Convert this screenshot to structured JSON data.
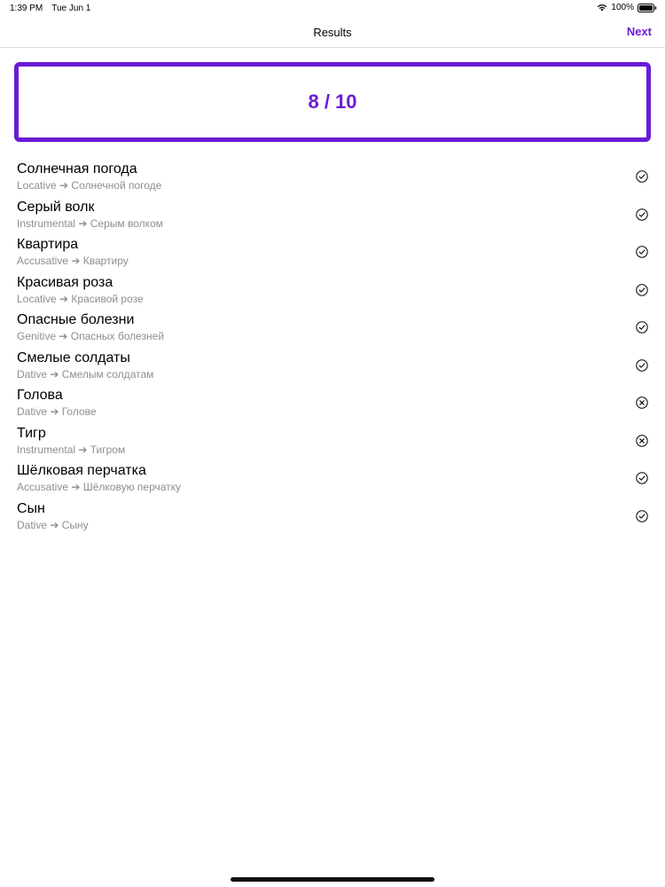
{
  "status": {
    "time": "1:39 PM",
    "date": "Tue Jun 1",
    "battery": "100%",
    "wifi_icon": "wifi-icon",
    "battery_icon": "battery-icon"
  },
  "nav": {
    "title": "Results",
    "next_label": "Next"
  },
  "score": {
    "text": "8 / 10",
    "correct": 8,
    "total": 10
  },
  "colors": {
    "accent": "#6a1bd6",
    "secondary_text": "#8e8e93"
  },
  "results": [
    {
      "word": "Солнечная погода",
      "detail": "Locative ➔ Солнечной погоде",
      "correct": true
    },
    {
      "word": "Серый волк",
      "detail": "Instrumental ➔ Серым волком",
      "correct": true
    },
    {
      "word": "Квартира",
      "detail": "Accusative ➔ Квартиру",
      "correct": true
    },
    {
      "word": "Красивая роза",
      "detail": "Locative ➔ Красивой розе",
      "correct": true
    },
    {
      "word": "Опасные болезни",
      "detail": "Genitive ➔ Опасных болезней",
      "correct": true
    },
    {
      "word": "Смелые солдаты",
      "detail": "Dative ➔ Смелым солдатам",
      "correct": true
    },
    {
      "word": "Голова",
      "detail": "Dative ➔ Голове",
      "correct": false
    },
    {
      "word": "Тигр",
      "detail": "Instrumental ➔ Тигром",
      "correct": false
    },
    {
      "word": "Шёлковая перчатка",
      "detail": "Accusative ➔ Шёлковую перчатку",
      "correct": true
    },
    {
      "word": "Сын",
      "detail": "Dative ➔ Сыну",
      "correct": true
    }
  ]
}
